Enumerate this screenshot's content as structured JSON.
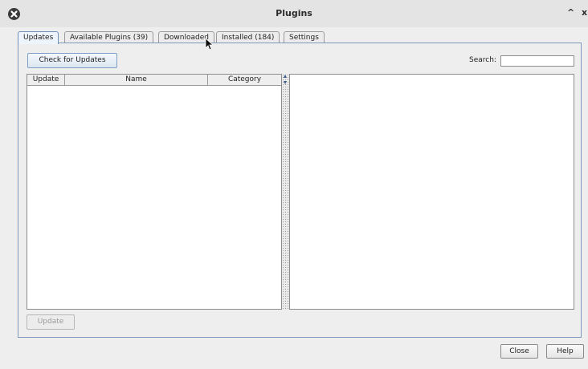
{
  "window": {
    "title": "Plugins",
    "buttons": {
      "minimize": "^",
      "close": "x"
    }
  },
  "tabs": [
    {
      "label": "Updates",
      "active": true
    },
    {
      "label": "Available Plugins (39)",
      "active": false
    },
    {
      "label": "Downloaded",
      "active": false
    },
    {
      "label": "Installed (184)",
      "active": false
    },
    {
      "label": "Settings",
      "active": false
    }
  ],
  "toolbar": {
    "check_updates_label": "Check for Updates",
    "search_label": "Search:",
    "search_value": ""
  },
  "table": {
    "columns": [
      "Update",
      "Name",
      "Category"
    ],
    "rows": []
  },
  "footer": {
    "update_label": "Update",
    "close_label": "Close",
    "help_label": "Help"
  },
  "icons": [
    "app-close-icon",
    "minimize-icon",
    "close-icon",
    "splitter-arrow-up-icon",
    "splitter-arrow-down-icon",
    "mouse-cursor-icon"
  ],
  "colors": {
    "accent": "#7d98bb",
    "tab_active": "#eef4fb"
  }
}
